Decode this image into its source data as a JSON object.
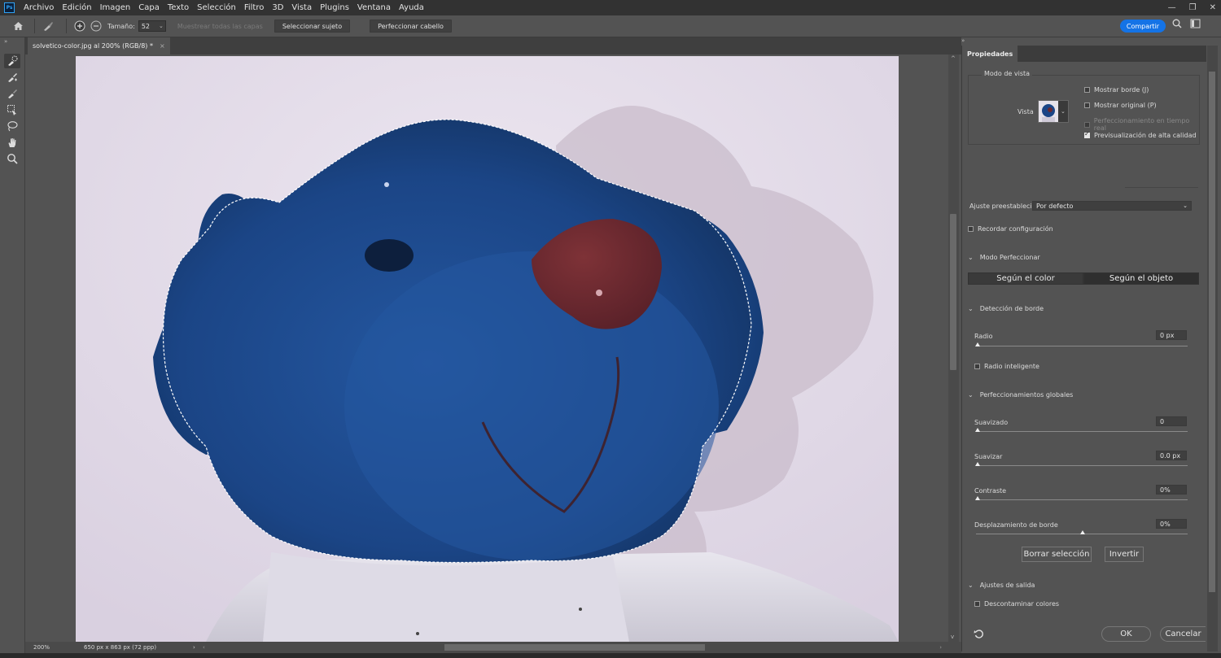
{
  "app": {
    "logo": "Ps"
  },
  "menu": [
    "Archivo",
    "Edición",
    "Imagen",
    "Capa",
    "Texto",
    "Selección",
    "Filtro",
    "3D",
    "Vista",
    "Plugins",
    "Ventana",
    "Ayuda"
  ],
  "window_controls": {
    "minimize": "—",
    "maximize": "❐",
    "close": "✕"
  },
  "options_bar": {
    "size_label": "Tamaño:",
    "size_value": "52",
    "sample_all_layers": "Muestrear todas las capas",
    "select_subject": "Seleccionar sujeto",
    "refine_hair": "Perfeccionar cabello",
    "share": "Compartir"
  },
  "document": {
    "tab_title": "solvetico-color.jpg al 200% (RGB/8) *",
    "tab_close": "×",
    "zoom": "200%",
    "dimensions": "650 px x 863 px (72 ppp)"
  },
  "properties": {
    "tab": "Propiedades",
    "view_mode_title": "Modo de vista",
    "view_label": "Vista",
    "view_options": [
      {
        "label": "Mostrar borde (J)",
        "checked": false,
        "enabled": true
      },
      {
        "label": "Mostrar original (P)",
        "checked": false,
        "enabled": true
      },
      {
        "label": "Perfeccionamiento en tiempo real",
        "checked": false,
        "enabled": false
      },
      {
        "label": "Previsualización de alta calidad",
        "checked": true,
        "enabled": true
      }
    ],
    "preset_label": "Ajuste preestablecido",
    "preset_value": "Por defecto",
    "remember_settings": "Recordar configuración",
    "refine_mode_title": "Modo Perfeccionar",
    "refine_mode_options": [
      "Según el color",
      "Según el objeto"
    ],
    "refine_mode_selected": 1,
    "edge_detection_title": "Detección de borde",
    "radius_label": "Radio",
    "radius_value": "0 px",
    "radius_level": 0,
    "smart_radius": "Radio inteligente",
    "global_title": "Perfeccionamientos globales",
    "sliders": [
      {
        "label": "Suavizado",
        "value": "0",
        "level": 0
      },
      {
        "label": "Suavizar",
        "value": "0.0 px",
        "level": 0
      },
      {
        "label": "Contraste",
        "value": "0%",
        "level": 0
      },
      {
        "label": "Desplazamiento de borde",
        "value": "0%",
        "level": 0.5
      }
    ],
    "clear_selection": "Borrar selección",
    "invert": "Invertir",
    "output_title": "Ajustes de salida",
    "decontaminate": "Descontaminar colores",
    "ok": "OK",
    "cancel": "Cancelar"
  },
  "colors": {
    "accent": "#1473e6",
    "bear_blue": "#1c4a8c",
    "nose": "#6b2930",
    "background_photo": "#e3dceb"
  }
}
